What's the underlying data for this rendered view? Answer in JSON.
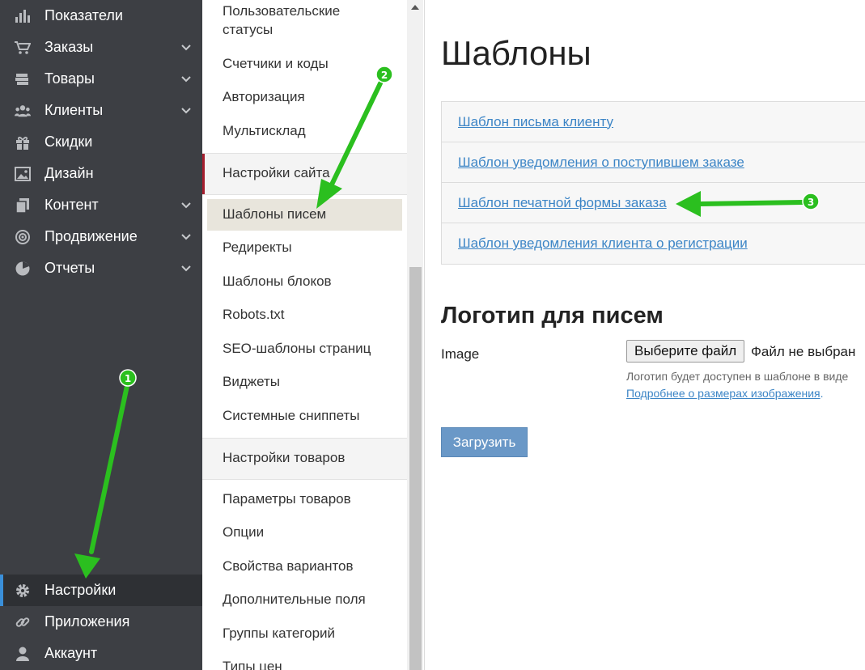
{
  "sidebar": {
    "items": [
      {
        "label": "Показатели",
        "icon": "bar-chart-icon",
        "has_submenu": false
      },
      {
        "label": "Заказы",
        "icon": "cart-icon",
        "has_submenu": true
      },
      {
        "label": "Товары",
        "icon": "books-icon",
        "has_submenu": true
      },
      {
        "label": "Клиенты",
        "icon": "users-icon",
        "has_submenu": true
      },
      {
        "label": "Скидки",
        "icon": "gift-icon",
        "has_submenu": false
      },
      {
        "label": "Дизайн",
        "icon": "image-icon",
        "has_submenu": false
      },
      {
        "label": "Контент",
        "icon": "pages-icon",
        "has_submenu": true
      },
      {
        "label": "Продвижение",
        "icon": "target-icon",
        "has_submenu": true
      },
      {
        "label": "Отчеты",
        "icon": "pie-chart-icon",
        "has_submenu": true
      }
    ],
    "bottom_items": [
      {
        "label": "Настройки",
        "icon": "gear-icon",
        "active": true
      },
      {
        "label": "Приложения",
        "icon": "link-icon",
        "active": false
      },
      {
        "label": "Аккаунт",
        "icon": "user-icon",
        "active": false
      }
    ]
  },
  "submenu": {
    "items_top": [
      {
        "label": "Пользовательские"
      },
      {
        "label": "статусы"
      },
      {
        "label": "Счетчики и коды"
      },
      {
        "label": "Авторизация"
      },
      {
        "label": "Мультисклад"
      }
    ],
    "section_site": "Настройки сайта",
    "items_site": [
      {
        "label": "Шаблоны писем",
        "active": true
      },
      {
        "label": "Редиректы"
      },
      {
        "label": "Шаблоны блоков"
      },
      {
        "label": "Robots.txt"
      },
      {
        "label": "SEO-шаблоны страниц"
      },
      {
        "label": "Виджеты"
      },
      {
        "label": "Системные сниппеты"
      }
    ],
    "section_products": "Настройки товаров",
    "items_products": [
      {
        "label": "Параметры товаров"
      },
      {
        "label": "Опции"
      },
      {
        "label": "Свойства вариантов"
      },
      {
        "label": "Дополнительные поля"
      },
      {
        "label": "Группы категорий"
      },
      {
        "label": "Типы цен"
      }
    ]
  },
  "main": {
    "title": "Шаблоны",
    "templates": [
      {
        "label": "Шаблон письма клиенту"
      },
      {
        "label": "Шаблон уведомления о поступившем заказе"
      },
      {
        "label": "Шаблон печатной формы заказа"
      },
      {
        "label": "Шаблон уведомления клиента о регистрации"
      }
    ],
    "logo_section": {
      "title": "Логотип для писем",
      "image_label": "Image",
      "file_button": "Выберите файл",
      "file_status": "Файл не выбран",
      "hint": "Логотип будет доступен в шаблоне в виде",
      "link_text": "Подробнее о размерах изображения",
      "link_suffix": ".",
      "upload_button": "Загрузить"
    }
  },
  "annotations": {
    "marker_1": "1",
    "marker_2": "2",
    "marker_3": "3",
    "arrow_color": "#2bbf1f"
  }
}
